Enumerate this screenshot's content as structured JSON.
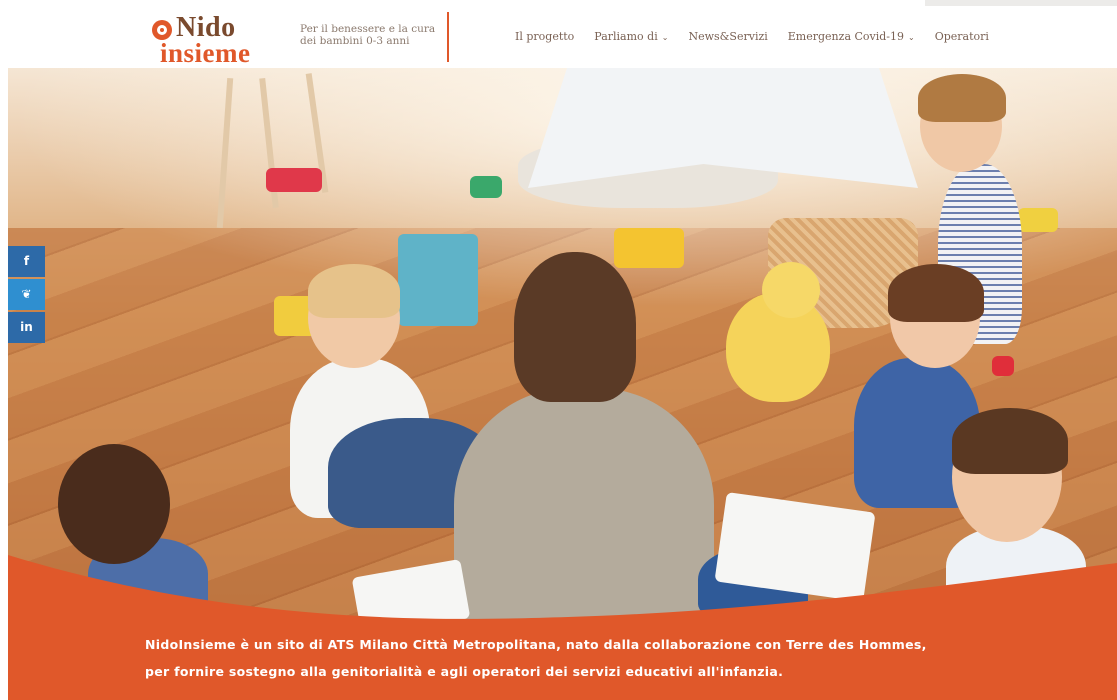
{
  "header": {
    "logo_line1": "Nido",
    "logo_line2": "insieme",
    "tagline_line1": "Per il benessere e la cura",
    "tagline_line2": "dei bambini 0-3 anni",
    "nav": [
      {
        "label": "Il progetto",
        "has_dropdown": false
      },
      {
        "label": "Parliamo di",
        "has_dropdown": true
      },
      {
        "label": "News&Servizi",
        "has_dropdown": false
      },
      {
        "label": "Emergenza Covid-19",
        "has_dropdown": true
      },
      {
        "label": "Operatori",
        "has_dropdown": false
      }
    ]
  },
  "share": {
    "facebook_glyph": "f",
    "twitter_glyph": "❦",
    "linkedin_glyph": "in"
  },
  "banner": {
    "line1": "NidoInsieme è un sito di ATS Milano Città Metropolitana, nato dalla collaborazione con Terre des Hommes,",
    "line2": "per fornire sostegno alla genitorialità e agli operatori dei servizi educativi all'infanzia."
  },
  "icons": [
    "logo-mark-icon",
    "chevron-down-icon",
    "facebook-icon",
    "twitter-icon",
    "linkedin-icon"
  ],
  "colors": {
    "accent": "#e0582a",
    "brand_brown": "#7a4a2e",
    "share_blue": "#2d6aa8",
    "twitter_blue": "#2f8fd0"
  }
}
